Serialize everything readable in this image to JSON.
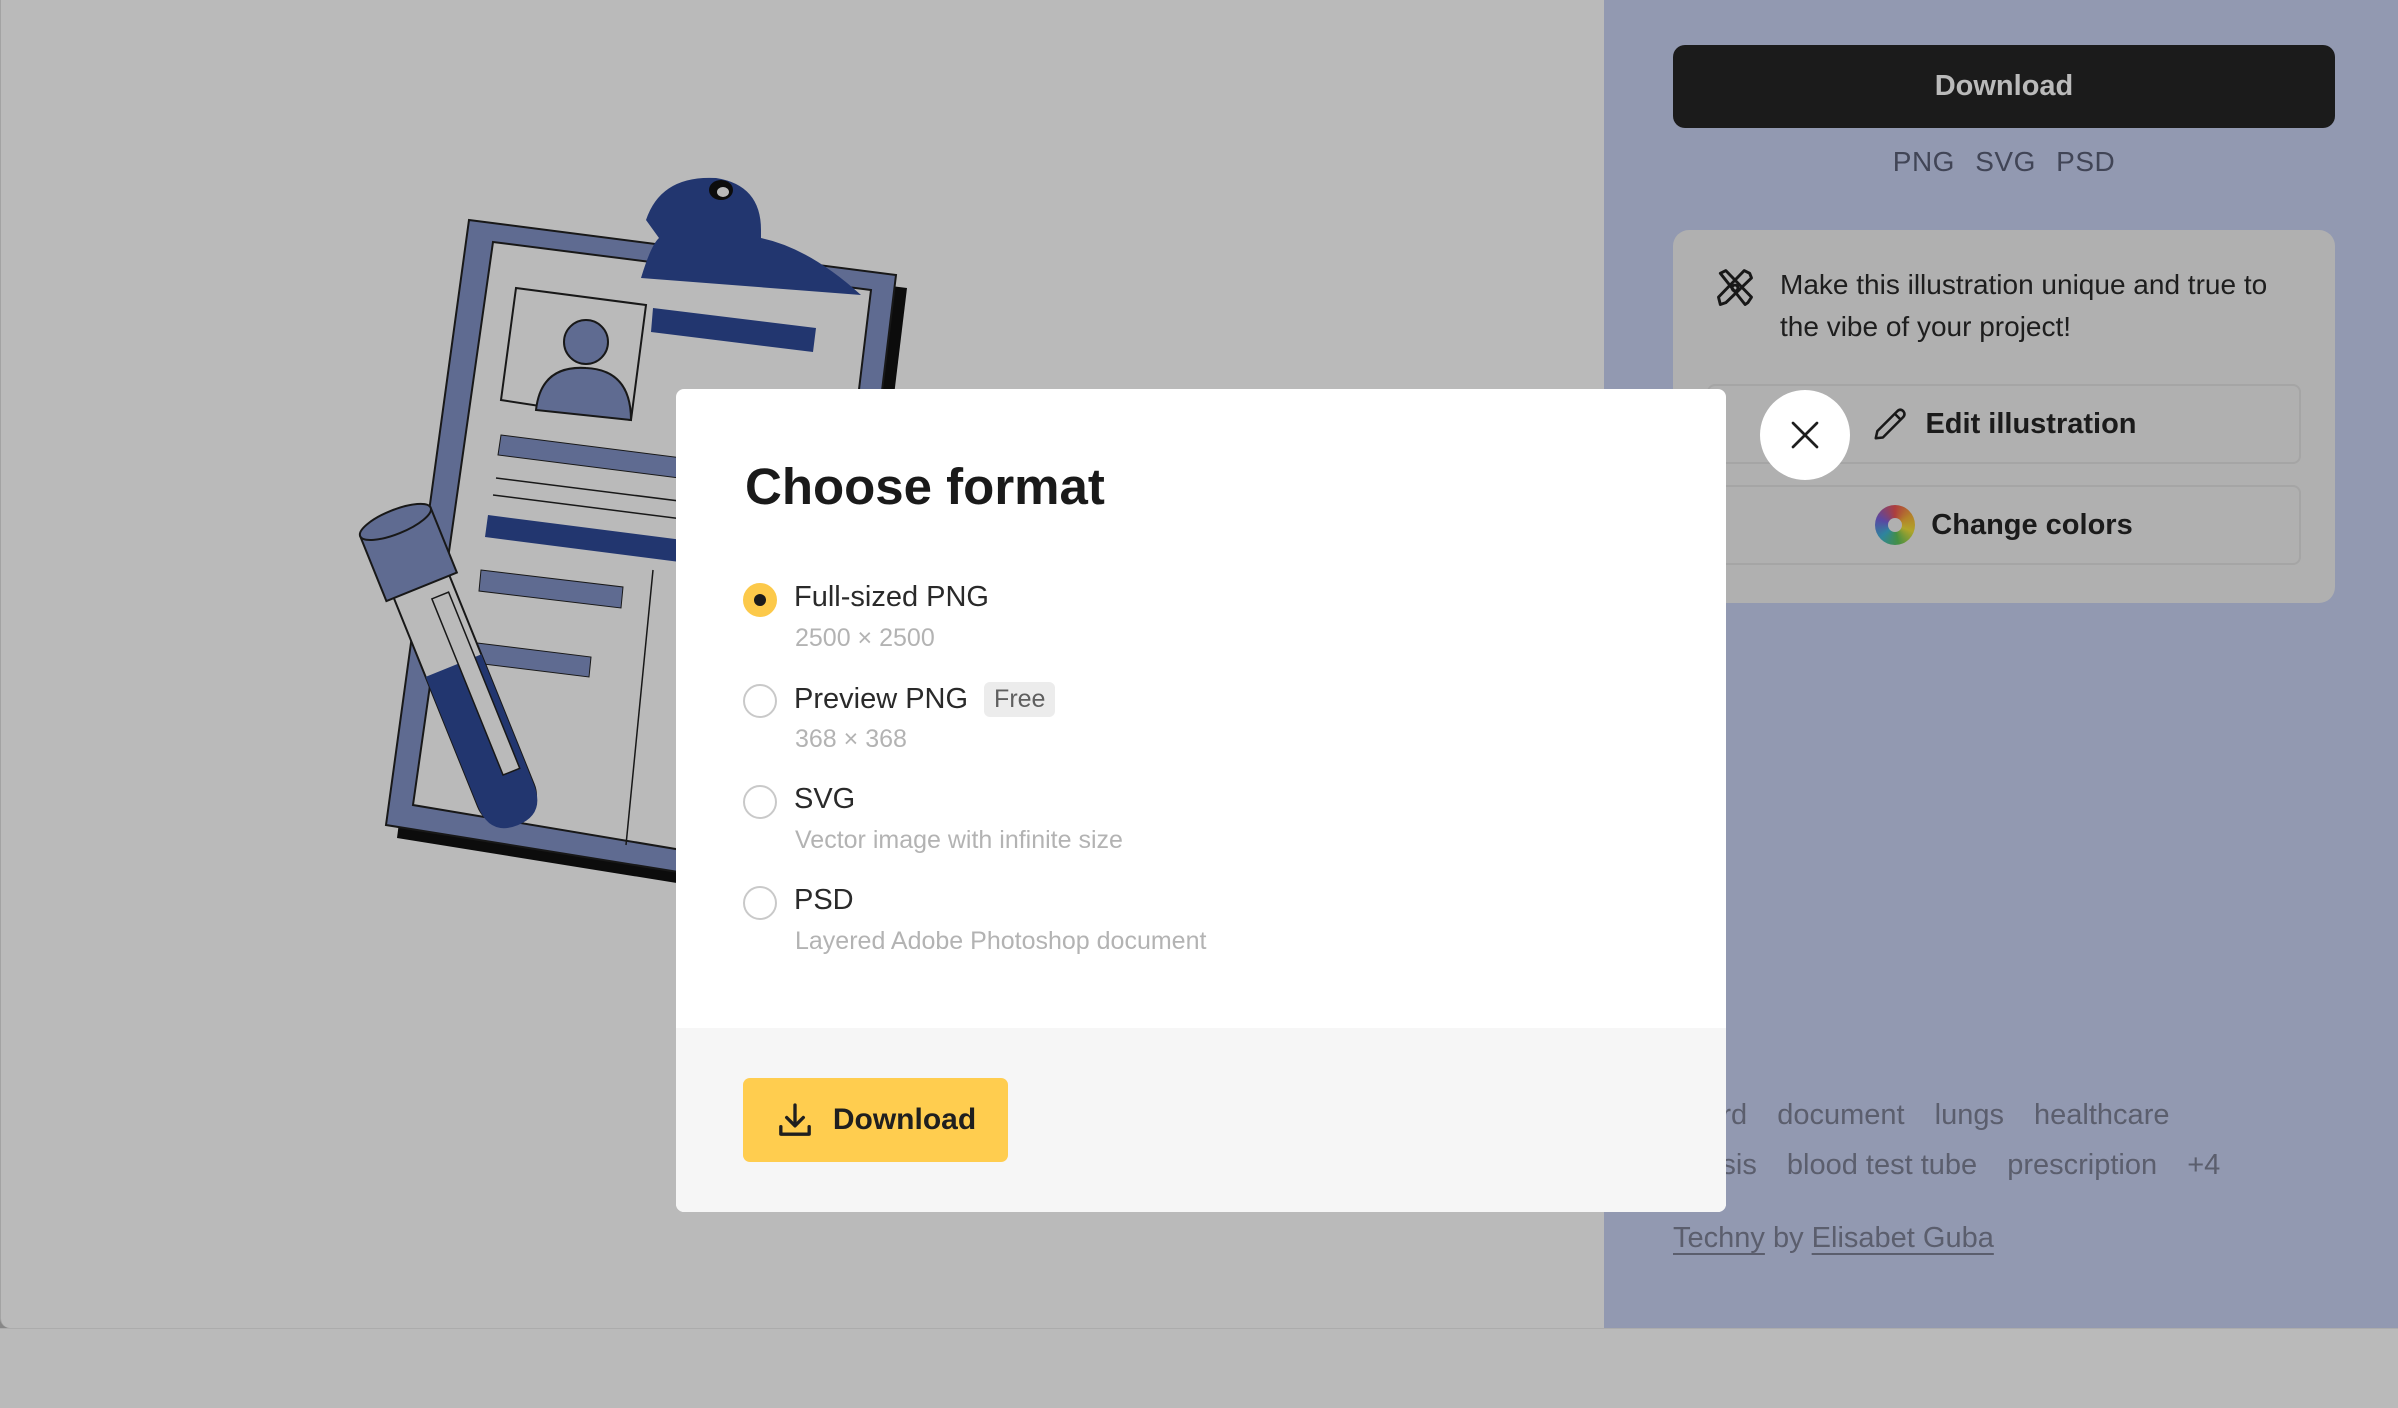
{
  "sidebar": {
    "download_label": "Download",
    "formats": [
      "PNG",
      "SVG",
      "PSD"
    ],
    "customize_card": {
      "icon": "design-tools-icon",
      "text": "Make this illustration unique and true to the vibe of your project!",
      "edit_label": "Edit illustration",
      "edit_icon": "pencil-icon",
      "colors_label": "Change colors",
      "colors_icon": "color-wheel-icon"
    },
    "tags_row1": [
      "board",
      "document",
      "lungs",
      "healthcare"
    ],
    "tags_row2": [
      "gnosis",
      "blood test tube",
      "prescription",
      "+4"
    ],
    "credit": {
      "style_link": "Techny",
      "by": "by",
      "author_link": "Elisabet Guba"
    }
  },
  "modal": {
    "title": "Choose format",
    "options": [
      {
        "label": "Full-sized PNG",
        "sub": "2500 × 2500",
        "checked": true,
        "badge": null
      },
      {
        "label": "Preview PNG",
        "sub": "368 × 368",
        "checked": false,
        "badge": "Free"
      },
      {
        "label": "SVG",
        "sub": "Vector image with infinite size",
        "checked": false,
        "badge": null
      },
      {
        "label": "PSD",
        "sub": "Layered Adobe Photoshop document",
        "checked": false,
        "badge": null
      }
    ],
    "download_label": "Download",
    "close_icon": "close-icon"
  },
  "colors": {
    "accent_yellow": "#ffcd4f",
    "illustration_dark_blue": "#2f4a99",
    "illustration_light_blue": "#8393c7"
  }
}
